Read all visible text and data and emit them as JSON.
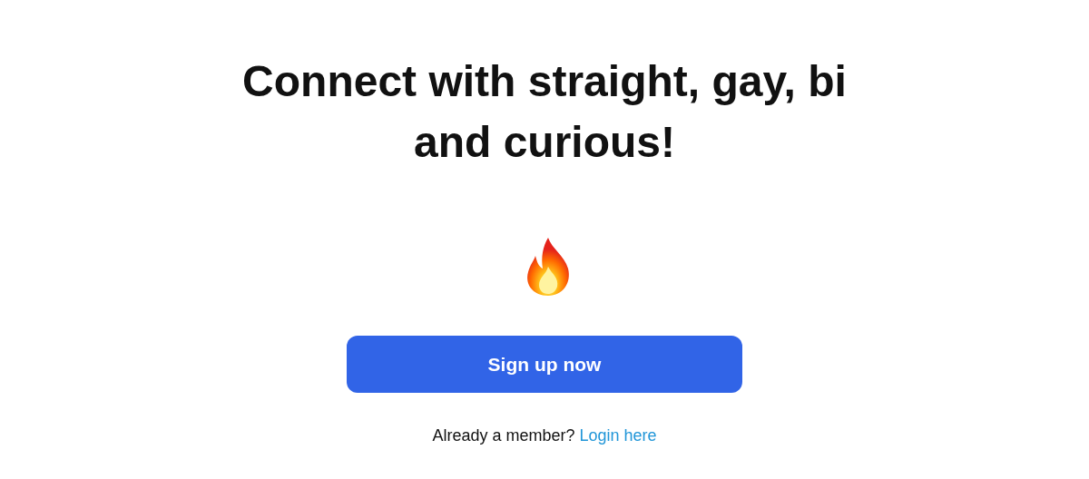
{
  "heading": "Connect with straight, gay, bi and curious!",
  "signup_button": {
    "label": "Sign up now"
  },
  "footer": {
    "text": "Already a member?",
    "link": "Login here"
  }
}
